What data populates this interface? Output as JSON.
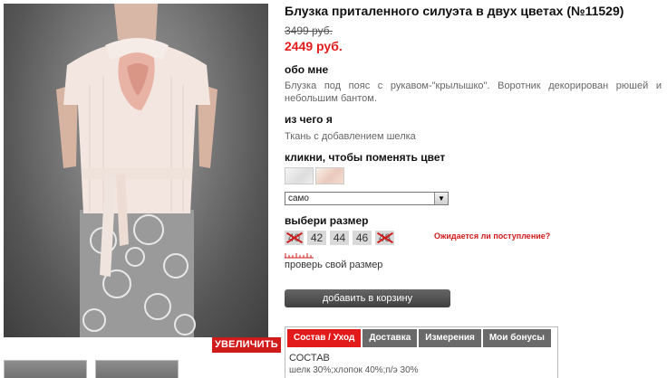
{
  "product": {
    "title": "Блузка приталенного силуэта в двух цветах (№11529)",
    "old_price": "3499 руб.",
    "new_price": "2449 руб."
  },
  "about": {
    "heading": "обо мне",
    "text": "Блузка под пояс с рукавом-\"крылышко\". Воротник декорирован рюшей и небольшим бантом."
  },
  "material": {
    "heading": "из чего я",
    "text": "Ткань с добавлением шелка"
  },
  "color": {
    "heading": "кликни, чтобы поменять цвет",
    "selected": "само",
    "swatches": [
      "white",
      "pink"
    ]
  },
  "size": {
    "heading": "выбери размер",
    "options": [
      {
        "label": "40",
        "available": false
      },
      {
        "label": "42",
        "available": true
      },
      {
        "label": "44",
        "available": true
      },
      {
        "label": "46",
        "available": true
      },
      {
        "label": "48",
        "available": false
      }
    ],
    "expect_link": "Ожидается ли поступление?",
    "check_link": "проверь свой размер"
  },
  "cart": {
    "add_label": "добавить в корзину"
  },
  "gallery": {
    "zoom_label": "УВЕЛИЧИТЬ"
  },
  "tabs": {
    "items": [
      "Состав / Уход",
      "Доставка",
      "Измерения",
      "Мои бонусы"
    ],
    "active_index": 0,
    "content_heading": "СОСТАВ",
    "content_text": "шелк 30%;хлопок 40%;п/э 30%"
  },
  "colors": {
    "accent_red": "#e41b1b",
    "tab_grey": "#6a6a6a",
    "button_dark": "#4a4a4a"
  }
}
